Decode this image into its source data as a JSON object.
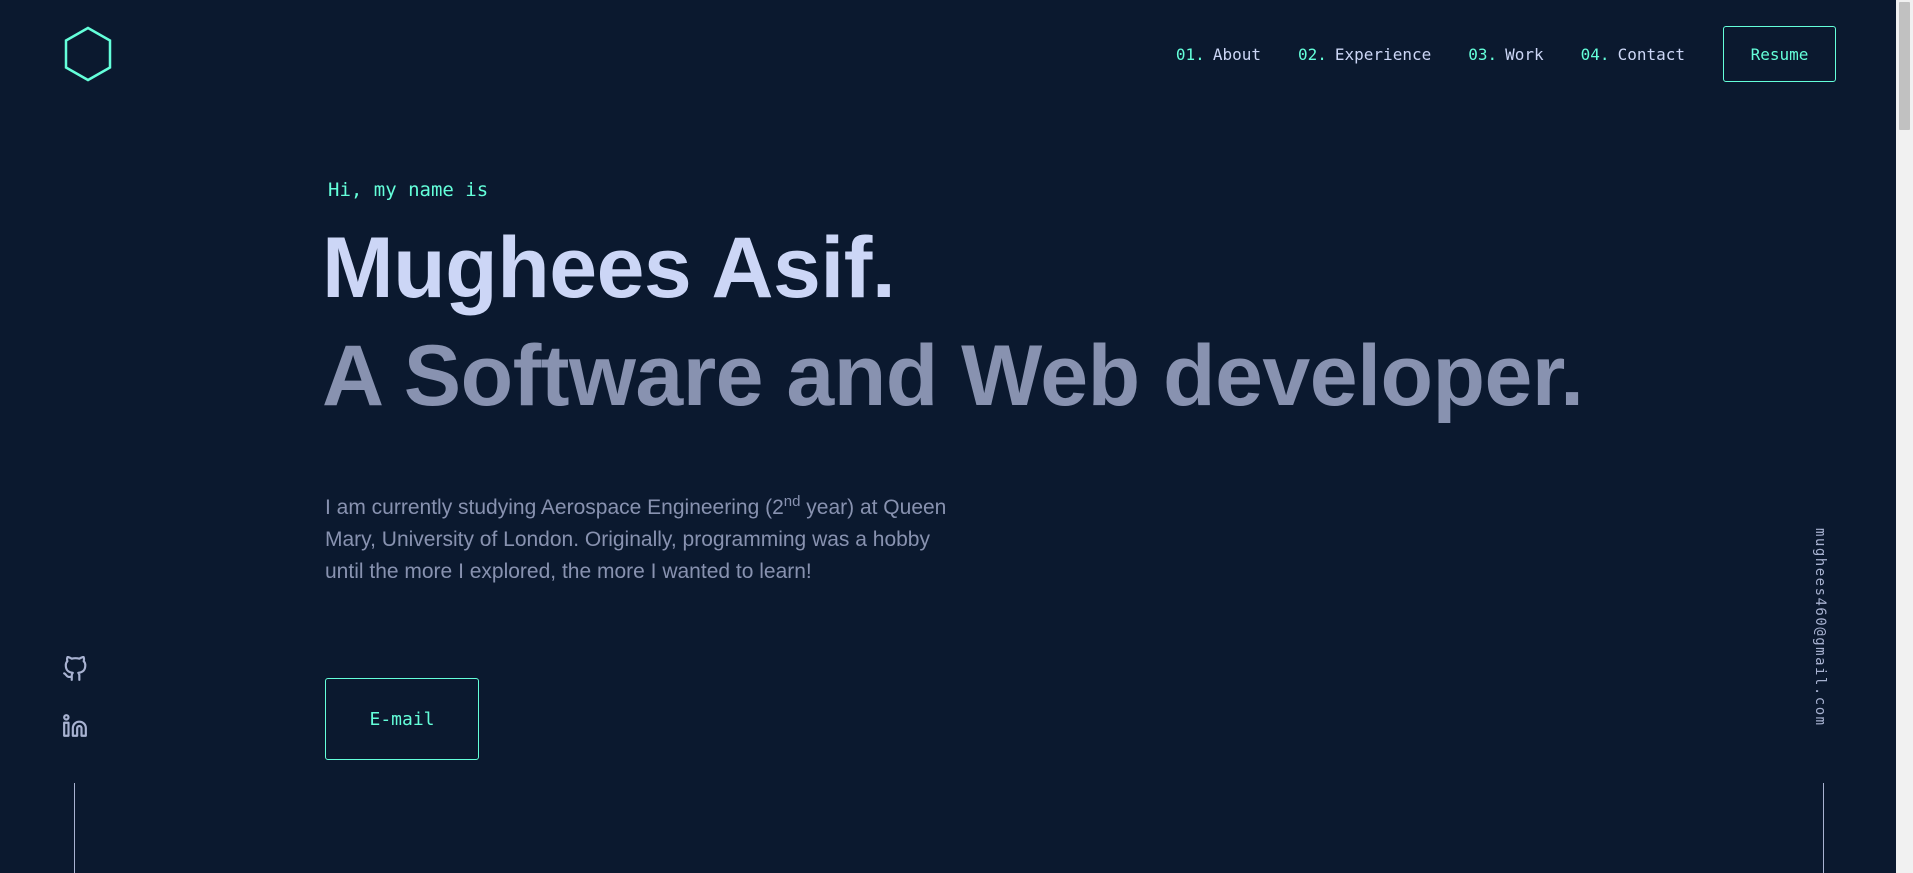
{
  "logo": {
    "icon": "hexagon-logo-icon",
    "color": "#64ffda"
  },
  "nav": {
    "items": [
      {
        "num": "01.",
        "label": "About"
      },
      {
        "num": "02.",
        "label": "Experience"
      },
      {
        "num": "03.",
        "label": "Work"
      },
      {
        "num": "04.",
        "label": "Contact"
      }
    ],
    "resume_label": "Resume"
  },
  "hero": {
    "greeting": "Hi, my name is",
    "name": "Mughees Asif.",
    "role": "A Software and Web developer.",
    "bio_part1": "I am currently studying Aerospace Engineering (2",
    "bio_sup": "nd",
    "bio_part2": " year) at Queen Mary, University of London. Originally, programming was a hobby until the more I explored, the more I wanted to learn!",
    "email_button": "E-mail"
  },
  "socials": [
    {
      "icon": "github-icon"
    },
    {
      "icon": "linkedin-icon"
    }
  ],
  "side_email": "mughees460@gmail.com",
  "colors": {
    "background": "#0b192f",
    "accent": "#64ffda",
    "heading": "#ccd6f6",
    "muted": "#8892b0"
  }
}
